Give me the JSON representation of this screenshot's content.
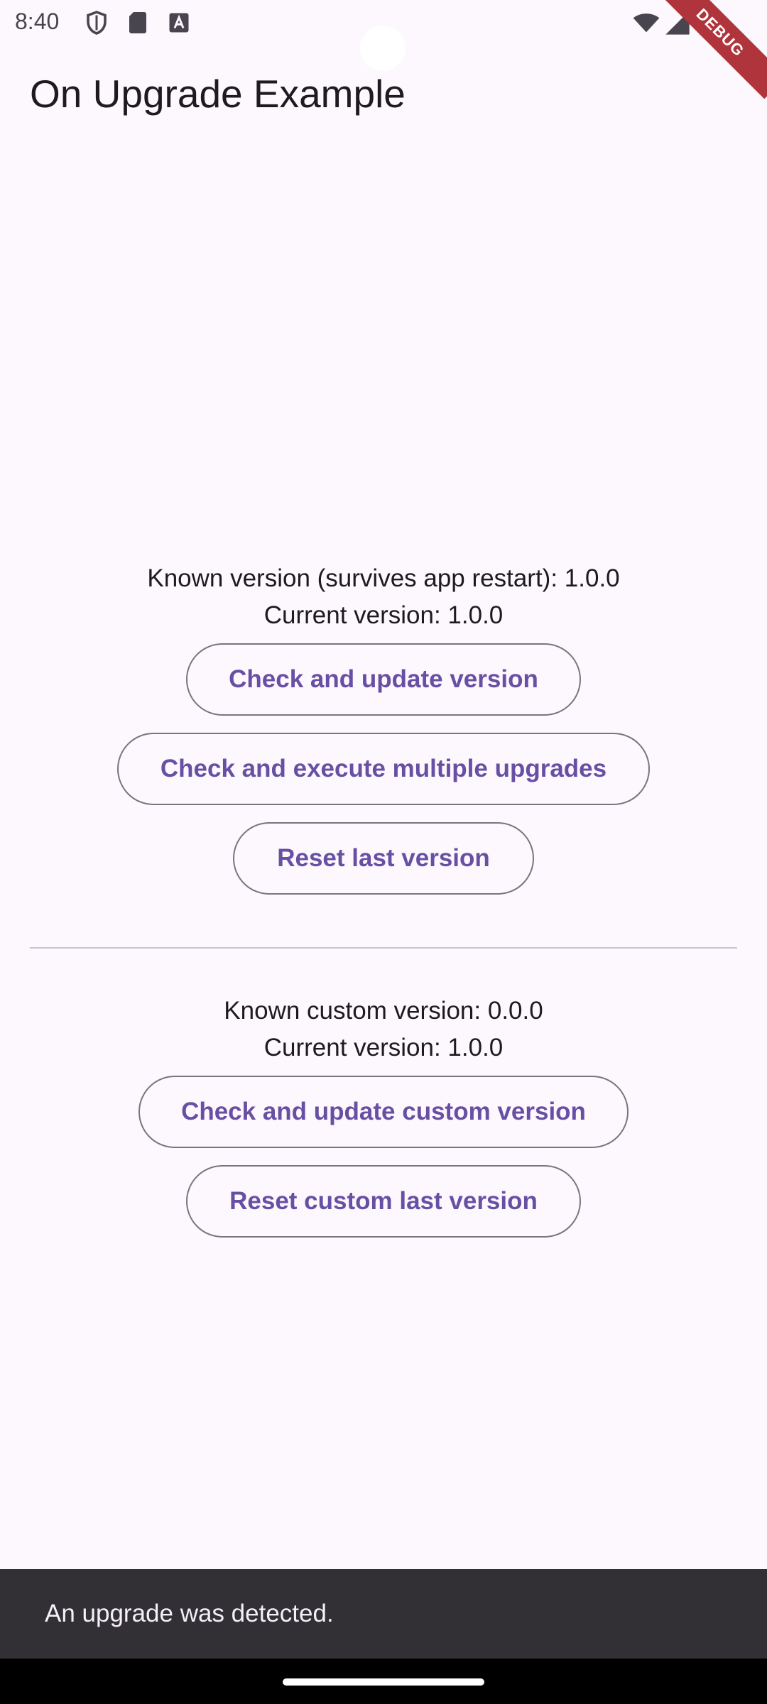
{
  "status_bar": {
    "time": "8:40",
    "icons": [
      "shield-icon",
      "sd-card-icon",
      "a-badge-icon",
      "wifi-icon",
      "cell-signal-icon",
      "battery-icon"
    ]
  },
  "debug_banner": {
    "label": "DEBUG"
  },
  "app_bar": {
    "title": "On Upgrade Example"
  },
  "section_default": {
    "known_version": "Known version (survives app restart): 1.0.0",
    "current_version": "Current version: 1.0.0",
    "buttons": {
      "check_update": "Check and update version",
      "check_execute_multiple": "Check and execute multiple upgrades",
      "reset_last": "Reset last version"
    }
  },
  "section_custom": {
    "known_version": "Known custom version: 0.0.0",
    "current_version": "Current version: 1.0.0",
    "buttons": {
      "check_update_custom": "Check and update custom version",
      "reset_custom_last": "Reset custom last version"
    }
  },
  "snackbar": {
    "message": "An upgrade was detected."
  },
  "colors": {
    "background": "#fdf7fe",
    "accent": "#6750a4",
    "outline": "#79747e",
    "snackbar": "#322f35",
    "debug_banner": "#b0343c"
  }
}
